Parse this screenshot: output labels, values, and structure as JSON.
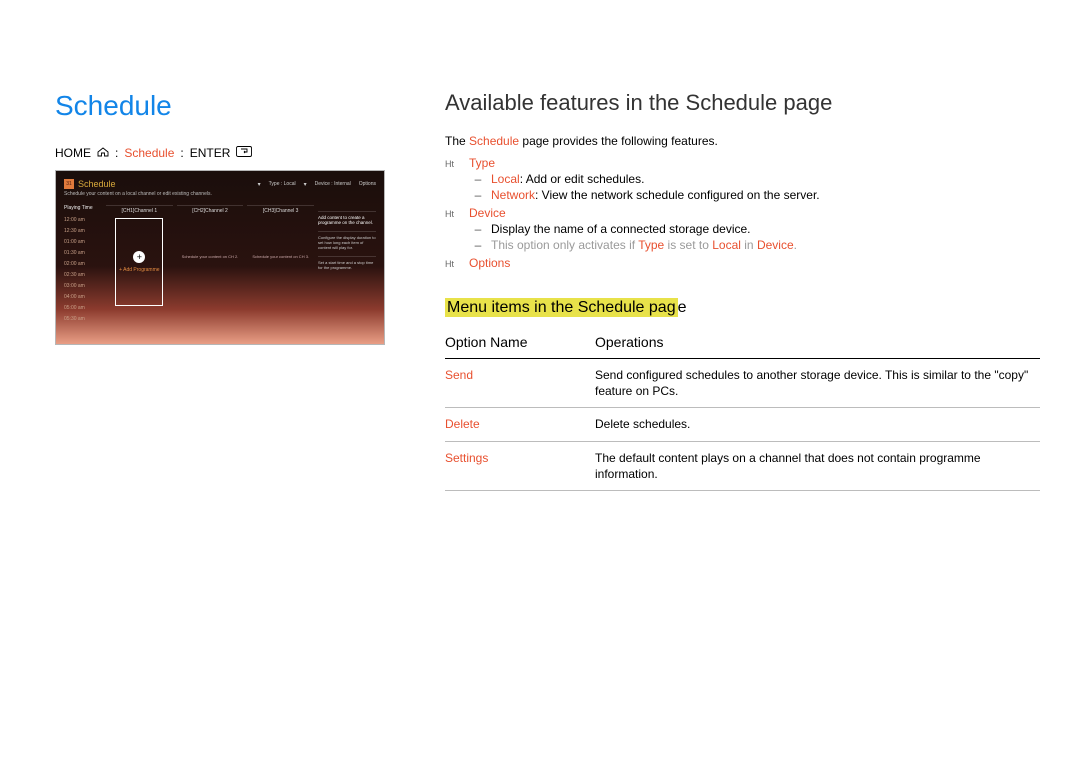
{
  "left": {
    "title": "Schedule",
    "breadcrumb": {
      "home": "HOME",
      "schedule": "Schedule",
      "enter": "ENTER",
      "sepA": " : ",
      "sepB": " : "
    }
  },
  "ui": {
    "title": "Schedule",
    "subtitle": "Schedule your content on a local channel or edit existing channels.",
    "topbar": {
      "type_label": "Type : Local",
      "device_label": "Device : Internal",
      "options": "Options"
    },
    "time_header": "Playing Time",
    "times": [
      "12:00 am",
      "12:30 am",
      "01:00 am",
      "01:30 am",
      "02:00 am",
      "02:30 am",
      "03:00 am",
      "04:00 am",
      "05:00 am",
      "05:30 am"
    ],
    "ch1": "[CH1]Channel 1",
    "ch2": "[CH2]Channel 2",
    "ch3": "[CH3]Channel 3",
    "add_programme": "+ Add Programme",
    "ch2_text": "Schedule your content on CH 2.",
    "ch3_text": "Schedule your content on CH 3.",
    "side1": "Add content to create a programme on the channel.",
    "side2": "Configure the display duration to set how long each item of content will play for.",
    "side3": "Set a start time and a stop time for the programme."
  },
  "right": {
    "h1": "Available features in the Schedule page",
    "intro_a": "The ",
    "intro_b": "Schedule",
    "intro_c": " page provides the following features.",
    "bullet": "Ht",
    "dash": "–",
    "type": {
      "label": "Type",
      "local_key": "Local",
      "local_desc": ": Add or edit schedules.",
      "net_key": "Network",
      "net_desc": ": View the network schedule configured on the server."
    },
    "device": {
      "label": "Device",
      "line1": "Display the name of a connected storage device.",
      "note_a": "This option only activates if ",
      "note_b": "Type",
      "note_c": " is set to ",
      "note_d": "Local",
      "note_e": " in ",
      "note_f": "Device",
      "note_g": "."
    },
    "options_label": "Options",
    "h2_a": "Menu items in the Schedule pag",
    "h2_b": "e",
    "table": {
      "col1": "Option Name",
      "col2": "Operations",
      "rows": [
        {
          "name": "Send",
          "desc": "Send configured schedules to another storage device. This is similar to the \"copy\" feature on PCs."
        },
        {
          "name": "Delete",
          "desc": "Delete schedules."
        },
        {
          "name": "Settings",
          "desc": "The default content plays on a channel that does not contain programme information."
        }
      ]
    }
  }
}
